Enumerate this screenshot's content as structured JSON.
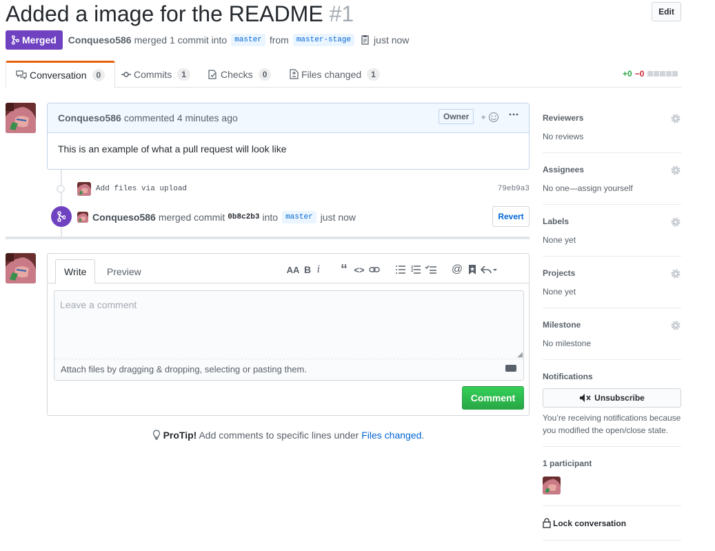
{
  "header": {
    "title": "Added a image for the README",
    "number": "#1",
    "edit_label": "Edit",
    "state_label": "Merged",
    "author": "Conqueso586",
    "merge_text": "merged 1 commit into",
    "base_branch": "master",
    "from_text": "from",
    "head_branch": "master-stage",
    "time": "just now"
  },
  "tabs": [
    {
      "label": "Conversation",
      "count": "0"
    },
    {
      "label": "Commits",
      "count": "1"
    },
    {
      "label": "Checks",
      "count": "0"
    },
    {
      "label": "Files changed",
      "count": "1"
    }
  ],
  "diffstat": {
    "additions": "+0",
    "deletions": "−0"
  },
  "comment": {
    "author": "Conqueso586",
    "action": "commented 4 minutes ago",
    "owner_label": "Owner",
    "body": "This is an example of what a pull request will look like"
  },
  "timeline": {
    "commit_message": "Add files via upload",
    "commit_sha": "79eb9a3",
    "merge_author": "Conqueso586",
    "merge_text": "merged commit",
    "merge_sha": "0b8c2b3",
    "into_text": "into",
    "merge_branch": "master",
    "merge_time": "just now",
    "revert_label": "Revert"
  },
  "form": {
    "write_tab": "Write",
    "preview_tab": "Preview",
    "placeholder": "Leave a comment",
    "attach_text": "Attach files by dragging & dropping, selecting or pasting them.",
    "submit_label": "Comment"
  },
  "protip": {
    "label": "ProTip!",
    "text": "Add comments to specific lines under",
    "link": "Files changed",
    "end": "."
  },
  "sidebar": {
    "reviewers": {
      "label": "Reviewers",
      "value": "No reviews"
    },
    "assignees": {
      "label": "Assignees",
      "value": "No one—assign yourself"
    },
    "labels": {
      "label": "Labels",
      "value": "None yet"
    },
    "projects": {
      "label": "Projects",
      "value": "None yet"
    },
    "milestone": {
      "label": "Milestone",
      "value": "No milestone"
    },
    "notifications": {
      "label": "Notifications",
      "button": "Unsubscribe",
      "line1": "You’re receiving notifications because",
      "line2": "you modified the open/close state."
    },
    "participants": {
      "label": "1 participant"
    },
    "lock": {
      "label": "Lock conversation"
    }
  },
  "colors": {
    "merged": "#6f42c1",
    "link": "#0366d6",
    "comment_green": "#28a745",
    "active_tab": "#e36209"
  }
}
